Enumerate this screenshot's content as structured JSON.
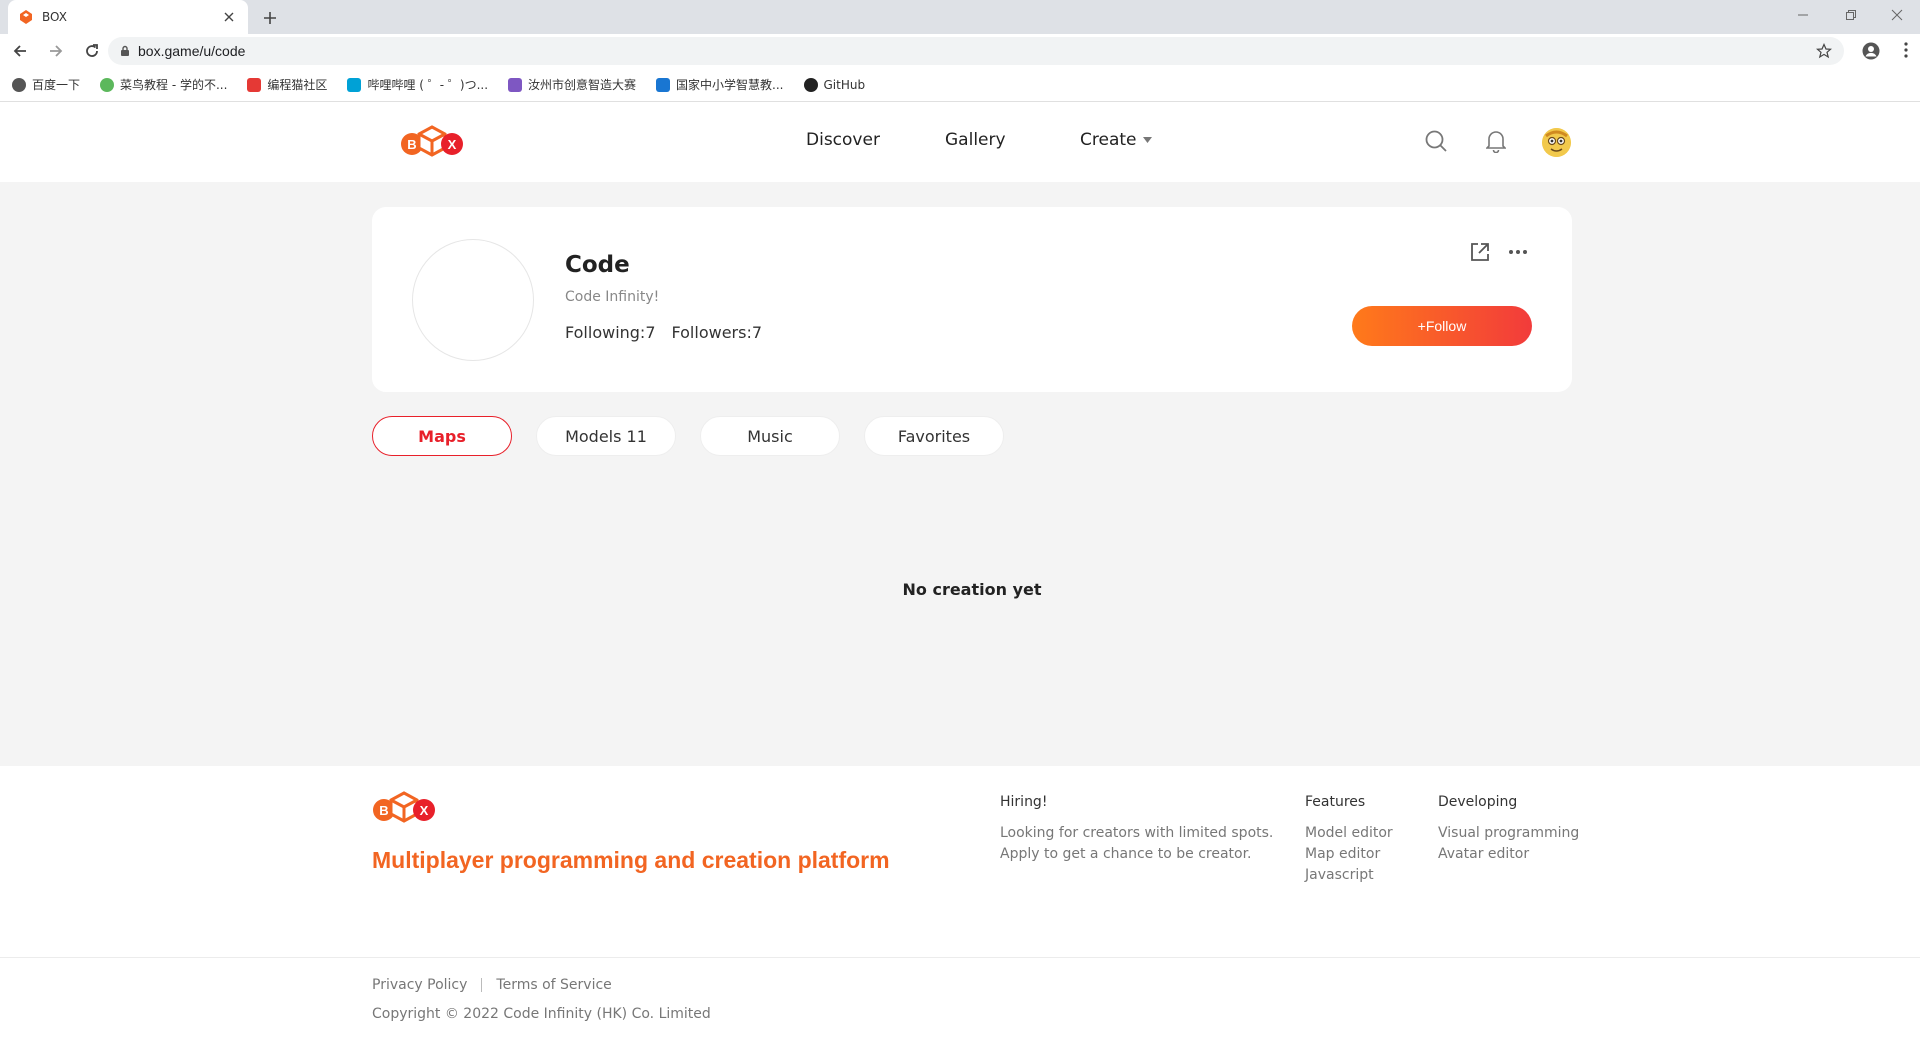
{
  "browser": {
    "tab_title": "BOX",
    "url": "box.game/u/code",
    "bookmarks": [
      {
        "label": "百度一下",
        "color": "#555555"
      },
      {
        "label": "菜鸟教程 - 学的不...",
        "color": "#5cb85c"
      },
      {
        "label": "编程猫社区",
        "color": "#e53935"
      },
      {
        "label": "哔哩哔哩 ( ゜- ゜)つ...",
        "color": "#00a1d6"
      },
      {
        "label": "汝州市创意智造大赛",
        "color": "#7e57c2"
      },
      {
        "label": "国家中小学智慧教...",
        "color": "#1976d2"
      },
      {
        "label": "GitHub",
        "color": "#222222"
      }
    ]
  },
  "header": {
    "nav": {
      "discover": "Discover",
      "gallery": "Gallery",
      "create": "Create"
    }
  },
  "profile": {
    "name": "Code",
    "bio": "Code Infinity!",
    "following": "Following:7",
    "followers": "Followers:7",
    "follow_label": "+Follow"
  },
  "tabs": {
    "maps": "Maps",
    "models": "Models 11",
    "music": "Music",
    "favorites": "Favorites"
  },
  "main": {
    "empty_text": "No creation yet"
  },
  "footer": {
    "tagline": "Multiplayer programming and creation platform",
    "hiring": {
      "title": "Hiring!",
      "line1": "Looking for creators with limited spots.",
      "line2": "Apply to get a chance to be creator."
    },
    "features": {
      "title": "Features",
      "items": [
        "Model editor",
        "Map editor",
        "Javascript"
      ]
    },
    "developing": {
      "title": "Developing",
      "items": [
        "Visual programming",
        "Avatar editor"
      ]
    },
    "privacy": "Privacy Policy",
    "terms": "Terms of Service",
    "copyright": "Copyright © 2022 Code Infinity (HK) Co. Limited"
  },
  "colors": {
    "brand_orange": "#f26522",
    "accent_red": "#e8202a"
  }
}
